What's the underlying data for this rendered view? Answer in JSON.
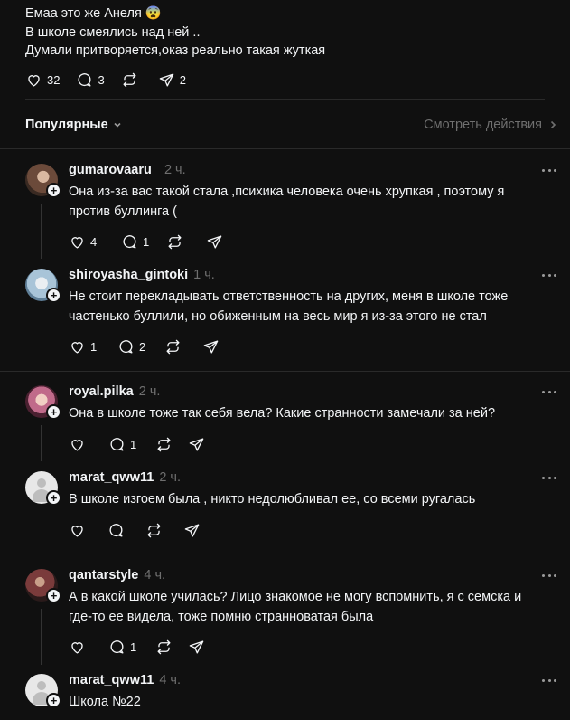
{
  "post": {
    "lines": [
      "Емаа это же Анеля 😨",
      "В школе смеялись над ней ..",
      "Думали притворяется,оказ реально такая жуткая"
    ],
    "likes": "32",
    "replies": "3",
    "reposts": "",
    "shares": "2"
  },
  "sort": {
    "label": "Популярные",
    "view_activity": "Смотреть действия"
  },
  "comments": [
    {
      "username": "gumarovaaru_",
      "time": "2 ч.",
      "lines": [
        "Она из-за вас такой стала ,психика человека очень хрупкая , поэтому я",
        "против буллинга ("
      ],
      "likes": "4",
      "replies": "1",
      "reposts": "",
      "avatar_color": "#6b4a3a"
    },
    {
      "username": "shiroyasha_gintoki",
      "time": "1 ч.",
      "lines": [
        "Не стоит перекладывать ответственность на других, меня в школе тоже",
        "частенько буллили, но обиженным на весь мир я из-за этого не стал"
      ],
      "likes": "1",
      "replies": "2",
      "reposts": "",
      "avatar_color": "#a8c4d8"
    },
    {
      "username": "royal.pilka",
      "time": "2 ч.",
      "lines": [
        "Она в школе тоже так себя вела? Какие странности замечали за ней?"
      ],
      "likes": "",
      "replies": "1",
      "reposts": "",
      "avatar_color": "#c06a8a"
    },
    {
      "username": "marat_qww11",
      "time": "2 ч.",
      "lines": [
        "В школе изгоем была , никто недолюбливал ее, со всеми ругалась"
      ],
      "likes": "",
      "replies": "",
      "reposts": "",
      "avatar_color": "#e8e8e8"
    },
    {
      "username": "qantarstyle",
      "time": "4 ч.",
      "lines": [
        "А в какой школе училась? Лицо знакомое не могу вспомнить, я с семска и",
        "где-то ее видела, тоже помню странноватая была"
      ],
      "likes": "",
      "replies": "1",
      "reposts": "",
      "avatar_color": "#7a3b3b"
    },
    {
      "username": "marat_qww11",
      "time": "4 ч.",
      "lines": [
        "Школа №22"
      ],
      "avatar_color": "#e8e8e8"
    }
  ]
}
